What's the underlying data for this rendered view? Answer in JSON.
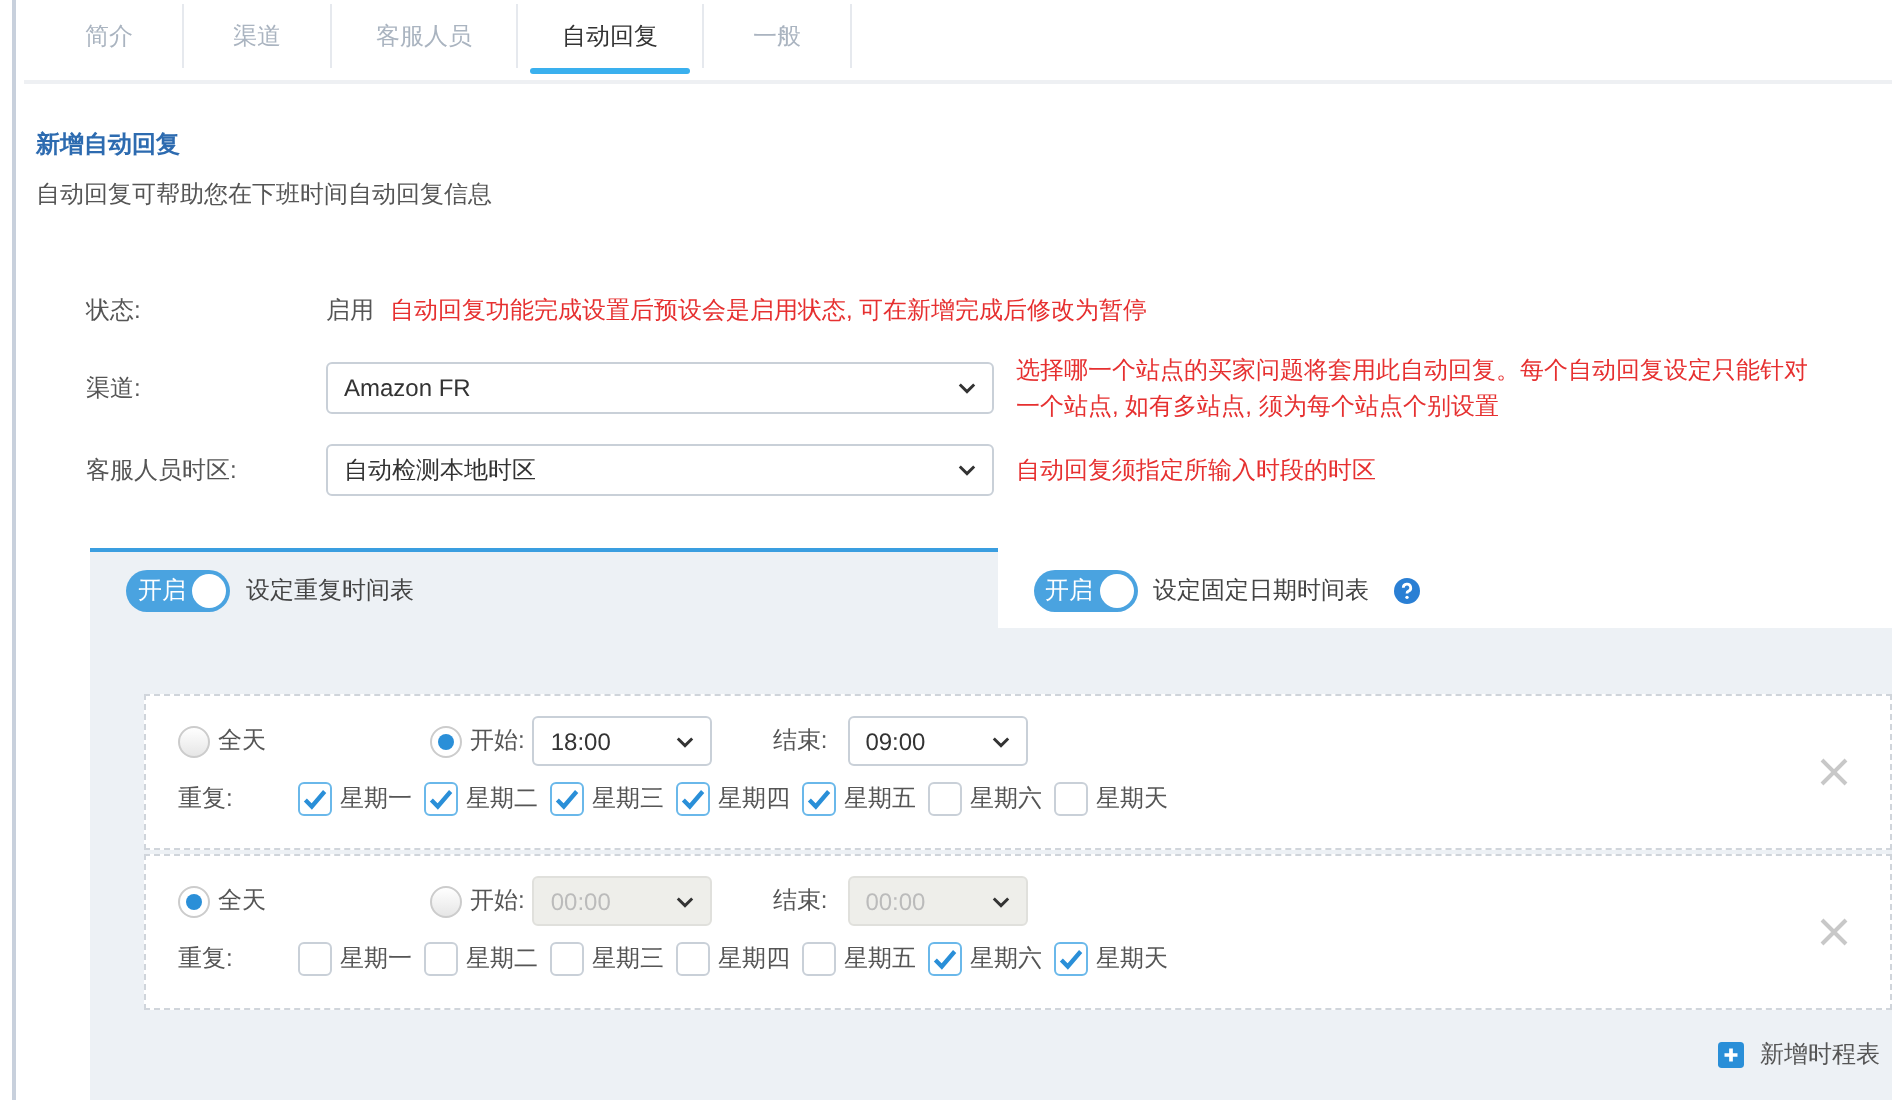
{
  "tabs": [
    {
      "label": "简介",
      "selected": false
    },
    {
      "label": "渠道",
      "selected": false
    },
    {
      "label": "客服人员",
      "selected": false
    },
    {
      "label": "自动回复",
      "selected": true
    },
    {
      "label": "一般",
      "selected": false
    }
  ],
  "heading": "新增自动回复",
  "subtitle": "自动回复可帮助您在下班时间自动回复信息",
  "status": {
    "label": "状态:",
    "value": "启用",
    "note": "自动回复功能完成设置后预设会是启用状态, 可在新增完成后修改为暂停"
  },
  "fields": [
    {
      "label": "渠道:",
      "value": "Amazon FR",
      "note": "选择哪一个站点的买家问题将套用此自动回复。每个自动回复设定只能针对一个站点, 如有多站点, 须为每个站点个别设置"
    },
    {
      "label": "客服人员时区:",
      "value": "自动检测本地时区",
      "note": "自动回复须指定所输入时段的时区"
    }
  ],
  "schedule_tabs": [
    {
      "toggle_label": "开启",
      "on": true,
      "label": "设定重复时间表",
      "selected": true,
      "help": false
    },
    {
      "toggle_label": "开启",
      "on": true,
      "label": "设定固定日期时间表",
      "selected": false,
      "help": true
    }
  ],
  "schedules": [
    {
      "all_day_label": "全天",
      "all_day": false,
      "start_label": "开始:",
      "start": "18:00",
      "end_label": "结束:",
      "end": "09:00",
      "repeat_label": "重复:",
      "days": [
        {
          "label": "星期一",
          "checked": true
        },
        {
          "label": "星期二",
          "checked": true
        },
        {
          "label": "星期三",
          "checked": true
        },
        {
          "label": "星期四",
          "checked": true
        },
        {
          "label": "星期五",
          "checked": true
        },
        {
          "label": "星期六",
          "checked": false
        },
        {
          "label": "星期天",
          "checked": false
        }
      ]
    },
    {
      "all_day_label": "全天",
      "all_day": true,
      "start_label": "开始:",
      "start": "00:00",
      "end_label": "结束:",
      "end": "00:00",
      "repeat_label": "重复:",
      "days": [
        {
          "label": "星期一",
          "checked": false
        },
        {
          "label": "星期二",
          "checked": false
        },
        {
          "label": "星期三",
          "checked": false
        },
        {
          "label": "星期四",
          "checked": false
        },
        {
          "label": "星期五",
          "checked": false
        },
        {
          "label": "星期六",
          "checked": true
        },
        {
          "label": "星期天",
          "checked": true
        }
      ]
    }
  ],
  "add_schedule": "新增时程表"
}
